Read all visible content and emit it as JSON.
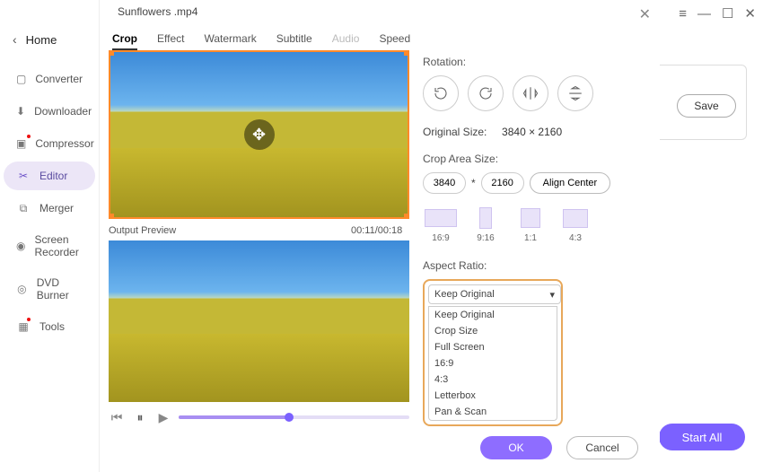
{
  "window": {
    "title": "Sunflowers .mp4"
  },
  "sidebar": {
    "home": "Home",
    "items": [
      {
        "label": "Converter",
        "icon": "converter"
      },
      {
        "label": "Downloader",
        "icon": "downloader"
      },
      {
        "label": "Compressor",
        "icon": "compressor",
        "dot": true
      },
      {
        "label": "Editor",
        "icon": "editor",
        "active": true
      },
      {
        "label": "Merger",
        "icon": "merger"
      },
      {
        "label": "Screen Recorder",
        "icon": "screen-recorder"
      },
      {
        "label": "DVD Burner",
        "icon": "dvd-burner"
      },
      {
        "label": "Tools",
        "icon": "tools",
        "dot": true
      }
    ]
  },
  "tabs": [
    {
      "label": "Crop",
      "sel": true
    },
    {
      "label": "Effect"
    },
    {
      "label": "Watermark"
    },
    {
      "label": "Subtitle"
    },
    {
      "label": "Audio",
      "disabled": true
    },
    {
      "label": "Speed"
    }
  ],
  "preview": {
    "output_label": "Output Preview",
    "time": "00:11/00:18"
  },
  "crop": {
    "rotation_label": "Rotation:",
    "original_size_label": "Original Size:",
    "original_size_value": "3840 × 2160",
    "crop_area_label": "Crop Area Size:",
    "width": "3840",
    "times": "*",
    "height": "2160",
    "align_center": "Align Center",
    "ratio_presets": [
      {
        "key": "r169",
        "label": "16:9"
      },
      {
        "key": "r916",
        "label": "9:16"
      },
      {
        "key": "r11",
        "label": "1:1"
      },
      {
        "key": "r43",
        "label": "4:3"
      }
    ],
    "aspect_label": "Aspect Ratio:",
    "aspect_selected": "Keep Original",
    "aspect_options": [
      "Keep Original",
      "Crop Size",
      "Full Screen",
      "16:9",
      "4:3",
      "Letterbox",
      "Pan & Scan"
    ]
  },
  "buttons": {
    "ok": "OK",
    "cancel": "Cancel",
    "save": "Save",
    "start_all": "Start All"
  }
}
